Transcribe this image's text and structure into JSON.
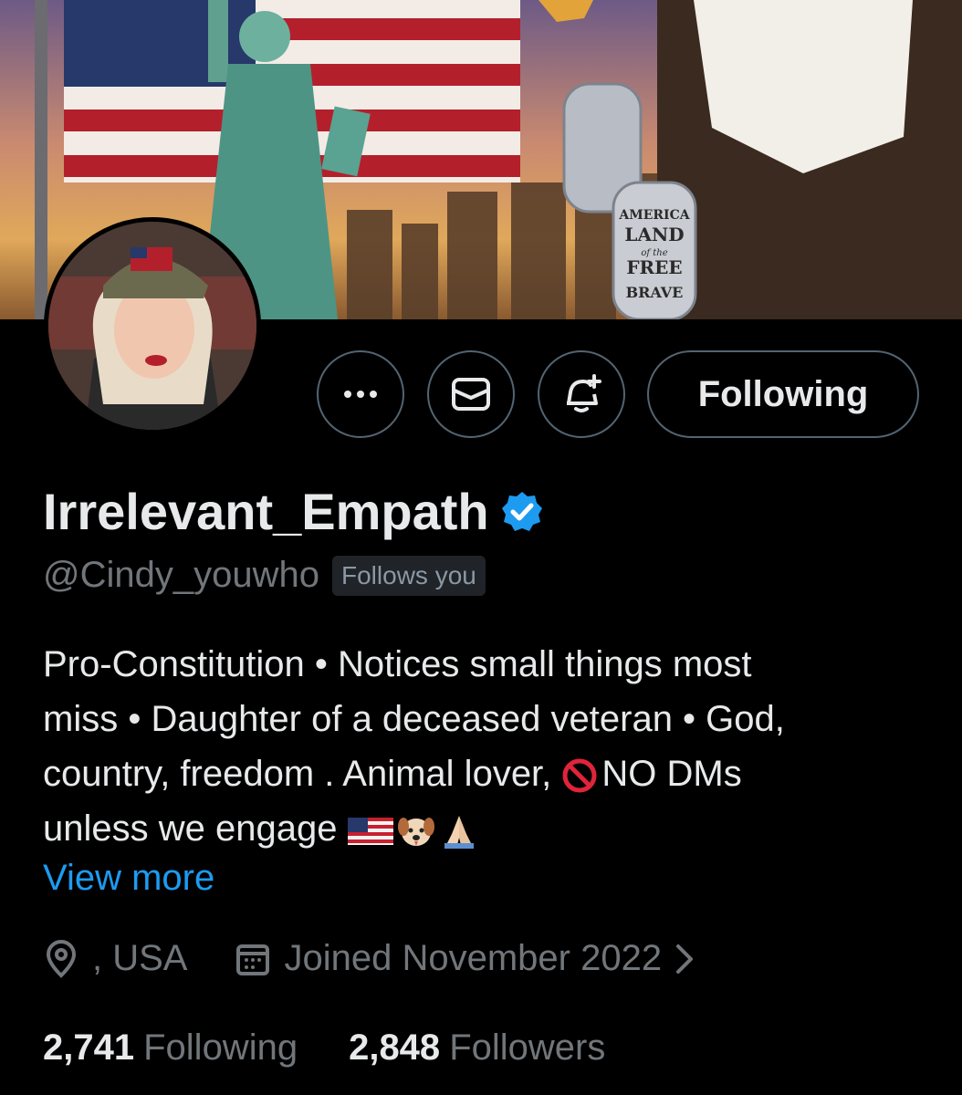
{
  "profile": {
    "display_name": "Irrelevant_Empath",
    "handle": "@Cindy_youwho",
    "follows_you_badge": "Follows you",
    "bio_lines": [
      "Pro-Constitution • Notices small things most",
      "miss • Daughter of a deceased veteran • God,",
      "country, freedom . Animal lover, ",
      "NO DMs",
      "unless we engage "
    ],
    "view_more_label": "View more",
    "location": ", USA",
    "joined": "Joined November 2022",
    "following_count": "2,741",
    "following_label": "Following",
    "followers_count": "2,848",
    "followers_label": "Followers"
  },
  "banner": {
    "dog_tag_lines": [
      "AMERICA",
      "LAND",
      "of the",
      "FREE",
      "BRAVE"
    ]
  },
  "actions": {
    "more_icon": "more-horizontal-icon",
    "message_icon": "envelope-icon",
    "notify_icon": "bell-plus-icon",
    "follow_label": "Following"
  },
  "icons": {
    "verified": "verified-badge-icon",
    "location": "location-pin-icon",
    "calendar": "calendar-icon",
    "chevron": "chevron-right-icon",
    "no_entry": "no-entry-emoji",
    "flag": "us-flag-emoji",
    "dog": "dog-face-emoji",
    "pray": "folded-hands-emoji"
  },
  "colors": {
    "background": "#000000",
    "text_primary": "#e7e9ea",
    "text_secondary": "#71767b",
    "link": "#1d9bf0",
    "verified": "#1d9bf0",
    "border": "#536471"
  }
}
